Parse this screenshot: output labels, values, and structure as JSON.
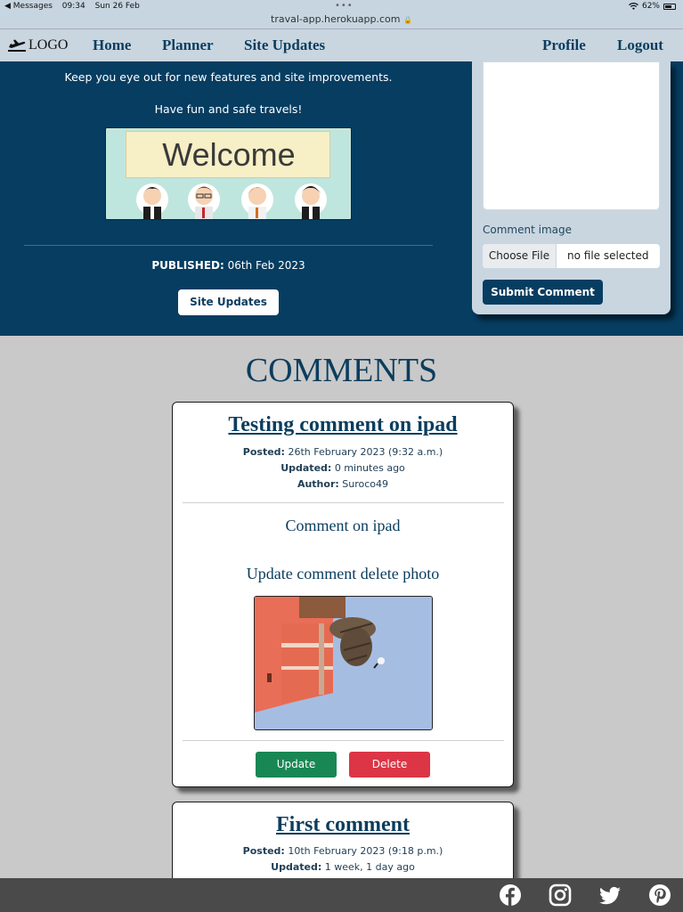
{
  "status_bar": {
    "back_app": "◀ Messages",
    "time": "09:34",
    "date": "Sun 26 Feb",
    "url": "traval-app.herokuapp.com",
    "battery": "62%"
  },
  "navbar": {
    "logo": "LOGO",
    "links": [
      "Home",
      "Planner",
      "Site Updates"
    ],
    "right_links": [
      "Profile",
      "Logout"
    ]
  },
  "hero": {
    "line1": "Keep you eye out for new features and site improvements.",
    "line2": "Have fun and safe travels!",
    "welcome_banner": "Welcome",
    "published_label": "PUBLISHED:",
    "published_date": "06th Feb 2023",
    "site_updates_button": "Site Updates"
  },
  "comment_form": {
    "image_label": "Comment image",
    "choose_file": "Choose File",
    "no_file": "no file selected",
    "submit": "Submit Comment"
  },
  "comments_heading": "COMMENTS",
  "comments": [
    {
      "title": "Testing comment on ipad",
      "posted_label": "Posted:",
      "posted": "26th February 2023 (9:32 a.m.)",
      "updated_label": "Updated:",
      "updated": "0 minutes ago",
      "author_label": "Author:",
      "author": "Suroco49",
      "body1": "Comment on ipad",
      "body2": "Update comment delete photo",
      "update_button": "Update",
      "delete_button": "Delete"
    },
    {
      "title": "First comment",
      "posted_label": "Posted:",
      "posted": "10th February 2023 (9:18 p.m.)",
      "updated_label": "Updated:",
      "updated": "1 week, 1 day ago"
    }
  ],
  "footer": {
    "icons": [
      "facebook-icon",
      "instagram-icon",
      "twitter-icon",
      "pinterest-icon"
    ]
  },
  "colors": {
    "brand_navy": "#063d61",
    "nav_bg": "#c9d6e0",
    "update_green": "#198754",
    "delete_red": "#dc3545",
    "footer_bg": "#4a4a4a"
  }
}
